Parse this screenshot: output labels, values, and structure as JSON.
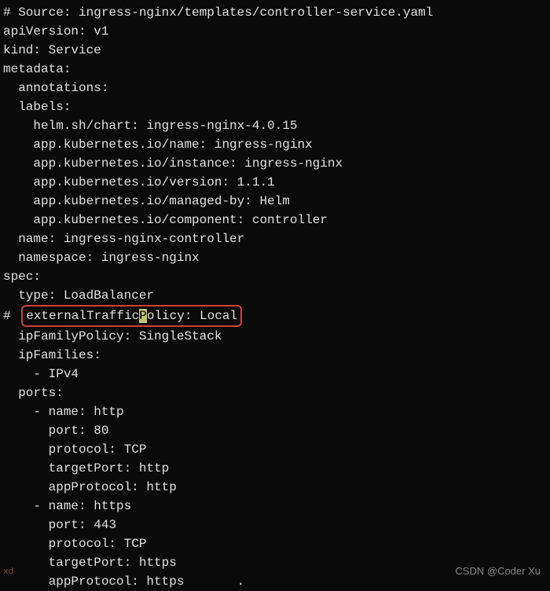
{
  "code": {
    "line01": "# Source: ingress-nginx/templates/controller-service.yaml",
    "line02": "apiVersion: v1",
    "line03": "kind: Service",
    "line04": "metadata:",
    "line05": "  annotations:",
    "line06": "  labels:",
    "line07": "    helm.sh/chart: ingress-nginx-4.0.15",
    "line08": "    app.kubernetes.io/name: ingress-nginx",
    "line09": "    app.kubernetes.io/instance: ingress-nginx",
    "line10": "    app.kubernetes.io/version: 1.1.1",
    "line11": "    app.kubernetes.io/managed-by: Helm",
    "line12": "    app.kubernetes.io/component: controller",
    "line13": "  name: ingress-nginx-controller",
    "line14": "  namespace: ingress-nginx",
    "line15": "spec:",
    "line16": "  type: LoadBalancer",
    "line17_prefix": "# ",
    "line17_part1": "externalTraffic",
    "line17_cursor": "P",
    "line17_part2": "olicy: Local",
    "line18": "  ipFamilyPolicy: SingleStack",
    "line19": "  ipFamilies:",
    "line20": "    - IPv4",
    "line21": "  ports:",
    "line22": "    - name: http",
    "line23": "      port: 80",
    "line24": "      protocol: TCP",
    "line25": "      targetPort: http",
    "line26": "      appProtocol: http",
    "line27": "    - name: https",
    "line28": "      port: 443",
    "line29": "      protocol: TCP",
    "line30": "      targetPort: https",
    "line31": "      appProtocol: https       ."
  },
  "watermark": "CSDN @Coder Xu",
  "left_mark": "xd"
}
